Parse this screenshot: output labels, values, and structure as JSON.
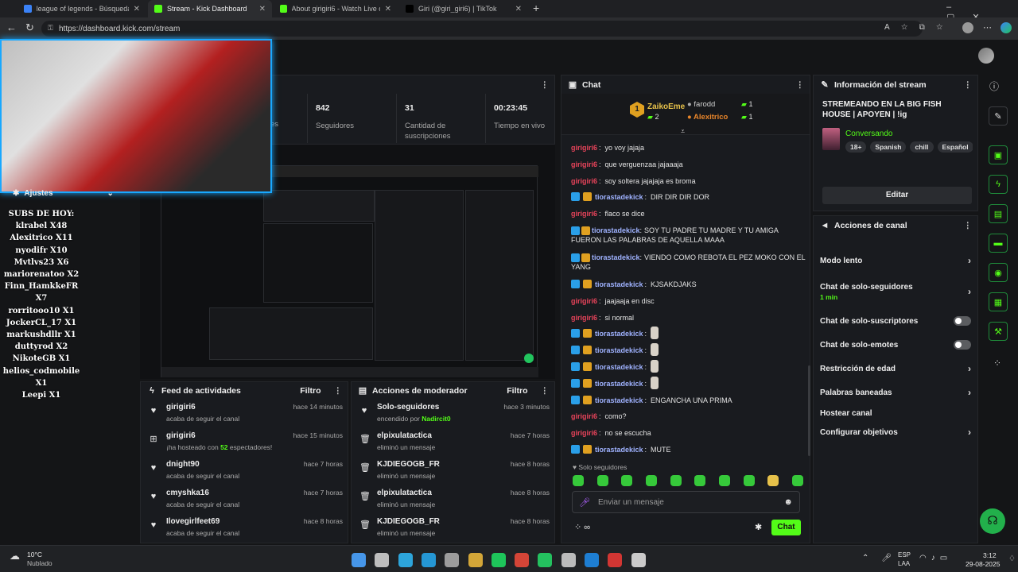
{
  "browser": {
    "tabs": [
      {
        "title": "league of legends - Búsqueda",
        "color": "#3b82f6"
      },
      {
        "title": "Stream - Kick Dashboard",
        "color": "#53fc18"
      },
      {
        "title": "About girigiri6 - Watch Live on Ki",
        "color": "#53fc18"
      },
      {
        "title": "Giri (@giri_giri6) | TikTok",
        "color": "#000000"
      }
    ],
    "url": "https://dashboard.kick.com/stream"
  },
  "overlay": {
    "settings_label": "Ajustes",
    "subs": [
      "SUBS DE HOY:",
      "klrabel X48",
      "Alexitrico X11",
      "nyodifr X10",
      "Mvtlvs23 X6",
      "mariorenatoo X2",
      "Finn_HamkkeFR X7",
      "rorritooo10 X1",
      "JockerCL_17 X1",
      "markushdllr X1",
      "duttyrod X2",
      "NikoteGB X1",
      "helios_codmobile X1",
      "Leepi X1"
    ]
  },
  "stats": [
    {
      "value": "842",
      "label": "Seguidores"
    },
    {
      "value": "31",
      "label": "Cantidad de suscripciones"
    },
    {
      "value": "00:23:45",
      "label": "Tiempo en vivo"
    }
  ],
  "stats_partial_label": "es",
  "feed": {
    "title": "Feed de actividades",
    "filter": "Filtro",
    "items": [
      {
        "icon": "heart-icon",
        "name": "girigiri6",
        "sub": "acaba de seguir el canal",
        "time": "hace 14 minutos"
      },
      {
        "icon": "host-icon",
        "name": "girigiri6",
        "sub_pre": "¡ha hosteado con ",
        "sub_num": "52",
        "sub_post": " espectadores!",
        "time": "hace 15 minutos"
      },
      {
        "icon": "heart-icon",
        "name": "dnight90",
        "sub": "acaba de seguir el canal",
        "time": "hace 7 horas"
      },
      {
        "icon": "heart-icon",
        "name": "cmyshka16",
        "sub": "acaba de seguir el canal",
        "time": "hace 7 horas"
      },
      {
        "icon": "heart-icon",
        "name": "Ilovegirlfeet69",
        "sub": "acaba de seguir el canal",
        "time": "hace 8 horas"
      }
    ]
  },
  "mod": {
    "title": "Acciones de moderador",
    "filter": "Filtro",
    "items": [
      {
        "icon": "heart-icon",
        "name": "Solo-seguidores",
        "sub_pre": "encendido por ",
        "sub_user": "Nadircit0",
        "time": "hace 3 minutos"
      },
      {
        "icon": "trash-icon",
        "name": "elpixulatactica",
        "sub": "eliminó un mensaje",
        "time": "hace 7 horas"
      },
      {
        "icon": "trash-icon",
        "name": "KJDIEGOGB_FR",
        "sub": "eliminó un mensaje",
        "time": "hace 8 horas"
      },
      {
        "icon": "trash-icon",
        "name": "elpixulatactica",
        "sub": "eliminó un mensaje",
        "time": "hace 8 horas"
      },
      {
        "icon": "trash-icon",
        "name": "KJDIEGOGB_FR",
        "sub": "eliminó un mensaje",
        "time": "hace 8 horas"
      }
    ]
  },
  "chat": {
    "title": "Chat",
    "leaderboard": {
      "first": {
        "rank": "1",
        "name": "ZaikoEme",
        "count": "2"
      },
      "second": {
        "name": "farodd",
        "count": "1"
      },
      "third": {
        "name": "Alexitrico",
        "count": "1"
      }
    },
    "messages": [
      {
        "user": "girigiri6",
        "color": "red",
        "text": "yo voy jajaja"
      },
      {
        "user": "girigiri6",
        "color": "red",
        "text": "que verguenzaa jajaaaja"
      },
      {
        "user": "girigiri6",
        "color": "red",
        "text": "soy soltera jajajaja es broma"
      },
      {
        "user": "tiorastadekick",
        "color": "blue",
        "badges": true,
        "text": "DIR DIR DIR DOR"
      },
      {
        "user": "girigiri6",
        "color": "red",
        "text": "flaco se dice"
      },
      {
        "user": "tiorastadekick",
        "color": "blue",
        "badges": true,
        "text": "SOY TU PADRE TU MADRE Y TU AMIGA FUERON LAS PALABRAS DE AQUELLA MAAA"
      },
      {
        "user": "tiorastadekick",
        "color": "blue",
        "badges": true,
        "text": "VIENDO COMO REBOTA EL PEZ MOKO CON EL YANG"
      },
      {
        "user": "tiorastadekick",
        "color": "blue",
        "badges": true,
        "text": "KJSAKDJAKS"
      },
      {
        "user": "girigiri6",
        "color": "red",
        "text": "jaajaaja en disc"
      },
      {
        "user": "girigiri6",
        "color": "red",
        "text": "si normal"
      },
      {
        "user": "tiorastadekick",
        "color": "blue",
        "badges": true,
        "emote": true,
        "text": ""
      },
      {
        "user": "tiorastadekick",
        "color": "blue",
        "badges": true,
        "emote": true,
        "text": ""
      },
      {
        "user": "tiorastadekick",
        "color": "blue",
        "badges": true,
        "emote": true,
        "text": ""
      },
      {
        "user": "tiorastadekick",
        "color": "blue",
        "badges": true,
        "emote": true,
        "text": ""
      },
      {
        "user": "tiorastadekick",
        "color": "blue",
        "badges": true,
        "text": "ENGANCHA UNA PRIMA"
      },
      {
        "user": "girigiri6",
        "color": "red",
        "text": "como?"
      },
      {
        "user": "girigiri6",
        "color": "red",
        "text": "no se escucha"
      },
      {
        "user": "tiorastadekick",
        "color": "blue",
        "badges": true,
        "text": "MUTE"
      }
    ],
    "followers_only": "Solo seguidores",
    "input_placeholder": "Enviar un mensaje",
    "send_label": "Chat"
  },
  "info": {
    "title": "Información del stream",
    "stream_title": "STREMEANDO EN LA BIG FISH HOUSE | APOYEN | !ig",
    "category": "Conversando",
    "tags": [
      "18+",
      "Spanish",
      "chill",
      "Español"
    ],
    "edit_label": "Editar"
  },
  "actions": {
    "title": "Acciones de canal",
    "items": [
      {
        "label": "Modo lento",
        "type": "chevron"
      },
      {
        "label": "Chat de solo-seguidores",
        "sub": "1 min",
        "type": "chevron"
      },
      {
        "label": "Chat de solo-suscriptores",
        "type": "toggle"
      },
      {
        "label": "Chat de solo-emotes",
        "type": "toggle"
      },
      {
        "label": "Restricción de edad",
        "type": "chevron"
      },
      {
        "label": "Palabras baneadas",
        "type": "chevron"
      },
      {
        "label": "Hostear canal",
        "type": "none"
      },
      {
        "label": "Configurar objetivos",
        "type": "chevron"
      }
    ]
  },
  "taskbar": {
    "weather_temp": "10°C",
    "weather_desc": "Nublado",
    "lang_top": "ESP",
    "lang_bottom": "LAA",
    "time": "3:12",
    "date": "29-08-2025"
  },
  "colors": {
    "kick_green": "#53fc18",
    "accent_blue": "#18a8ff",
    "user_red": "#e8435a"
  }
}
